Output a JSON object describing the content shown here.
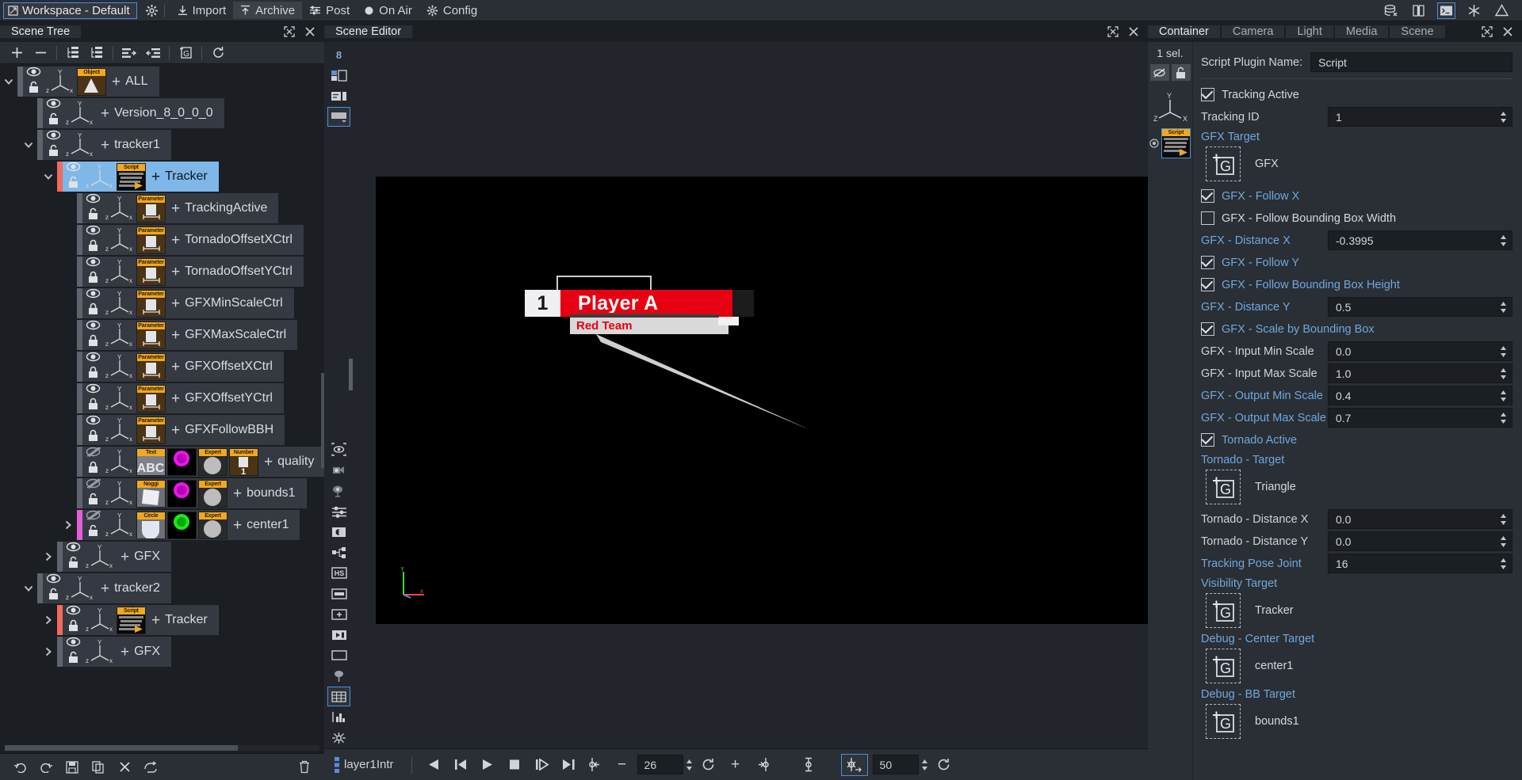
{
  "menubar": {
    "workspace_label": "Workspace - Default",
    "items": [
      {
        "label": "Import",
        "icon": "import-icon"
      },
      {
        "label": "Archive",
        "icon": "archive-icon",
        "active": true
      },
      {
        "label": "Post",
        "icon": "post-icon"
      },
      {
        "label": "On Air",
        "icon": "onair-icon"
      },
      {
        "label": "Config",
        "icon": "config-icon"
      }
    ],
    "right_icons": [
      "database-icon",
      "book-icon",
      "console-icon",
      "snowflake-icon",
      "warning-icon"
    ]
  },
  "scene_tree": {
    "tab_label": "Scene Tree",
    "toolbar": [
      "add-icon",
      "remove-icon",
      "expand-tree-icon",
      "collapse-tree-icon",
      "indent-right-icon",
      "indent-left-icon",
      "group-icon",
      "refresh-icon"
    ],
    "header_tools": [
      "maximize-icon",
      "close-icon"
    ],
    "footer": [
      "undo-icon",
      "redo-icon",
      "save-icon",
      "copy-icon",
      "delete-icon",
      "link-icon",
      "trash-icon"
    ],
    "items": [
      {
        "label": "ALL",
        "depth": 0,
        "twist": "down",
        "selected": false,
        "locked": false,
        "visible": true,
        "thumbs": [
          {
            "cap": "Object",
            "kind": "cone"
          }
        ]
      },
      {
        "label": "Version_8_0_0_0",
        "depth": 1,
        "twist": "",
        "selected": false,
        "locked": false,
        "visible": true,
        "thumbs": []
      },
      {
        "label": "tracker1",
        "depth": 1,
        "twist": "down",
        "selected": false,
        "locked": false,
        "visible": true,
        "thumbs": []
      },
      {
        "label": "Tracker",
        "depth": 2,
        "twist": "down",
        "selected": true,
        "locked": false,
        "visible": true,
        "accent": "#f2695e",
        "thumbs": [
          {
            "cap": "Script",
            "kind": "script"
          }
        ]
      },
      {
        "label": "TrackingActive",
        "depth": 3,
        "twist": "",
        "selected": false,
        "locked": false,
        "visible": true,
        "thumbs": [
          {
            "cap": "Parameter",
            "kind": "param"
          }
        ]
      },
      {
        "label": "TornadoOffsetXCtrl",
        "depth": 3,
        "twist": "",
        "selected": false,
        "locked": true,
        "visible": true,
        "thumbs": [
          {
            "cap": "Parameter",
            "kind": "param"
          }
        ]
      },
      {
        "label": "TornadoOffsetYCtrl",
        "depth": 3,
        "twist": "",
        "selected": false,
        "locked": true,
        "visible": true,
        "thumbs": [
          {
            "cap": "Parameter",
            "kind": "param"
          }
        ]
      },
      {
        "label": "GFXMinScaleCtrl",
        "depth": 3,
        "twist": "",
        "selected": false,
        "locked": true,
        "visible": true,
        "thumbs": [
          {
            "cap": "Parameter",
            "kind": "param"
          }
        ]
      },
      {
        "label": "GFXMaxScaleCtrl",
        "depth": 3,
        "twist": "",
        "selected": false,
        "locked": true,
        "visible": true,
        "thumbs": [
          {
            "cap": "Parameter",
            "kind": "param"
          }
        ]
      },
      {
        "label": "GFXOffsetXCtrl",
        "depth": 3,
        "twist": "",
        "selected": false,
        "locked": true,
        "visible": true,
        "thumbs": [
          {
            "cap": "Parameter",
            "kind": "param"
          }
        ]
      },
      {
        "label": "GFXOffsetYCtrl",
        "depth": 3,
        "twist": "",
        "selected": false,
        "locked": true,
        "visible": true,
        "thumbs": [
          {
            "cap": "Parameter",
            "kind": "param"
          }
        ]
      },
      {
        "label": "GFXFollowBBH",
        "depth": 3,
        "twist": "",
        "selected": false,
        "locked": true,
        "visible": true,
        "thumbs": [
          {
            "cap": "Parameter",
            "kind": "param"
          }
        ]
      },
      {
        "label": "quality",
        "depth": 3,
        "twist": "",
        "selected": false,
        "locked": true,
        "visible": false,
        "thumbs": [
          {
            "cap": "Text",
            "kind": "abc"
          },
          {
            "cap": "",
            "kind": "magenta"
          },
          {
            "cap": "Expert",
            "kind": "sphere"
          },
          {
            "cap": "Number",
            "kind": "number"
          }
        ]
      },
      {
        "label": "bounds1",
        "depth": 3,
        "twist": "",
        "selected": false,
        "locked": false,
        "visible": false,
        "thumbs": [
          {
            "cap": "Noggi",
            "kind": "plane"
          },
          {
            "cap": "",
            "kind": "magenta"
          },
          {
            "cap": "Expert",
            "kind": "sphere"
          }
        ]
      },
      {
        "label": "center1",
        "depth": 3,
        "twist": "right",
        "selected": false,
        "locked": false,
        "visible": false,
        "accent": "#e35fd8",
        "thumbs": [
          {
            "cap": "Circle",
            "kind": "circle"
          },
          {
            "cap": "",
            "kind": "green"
          },
          {
            "cap": "Expert",
            "kind": "sphere"
          }
        ]
      },
      {
        "label": "GFX",
        "depth": 2,
        "twist": "right",
        "selected": false,
        "locked": false,
        "visible": true,
        "thumbs": []
      },
      {
        "label": "tracker2",
        "depth": 1,
        "twist": "down",
        "selected": false,
        "locked": false,
        "visible": true,
        "thumbs": []
      },
      {
        "label": "Tracker",
        "depth": 2,
        "twist": "right",
        "selected": false,
        "locked": true,
        "visible": true,
        "accent": "#f2695e",
        "thumbs": [
          {
            "cap": "Script",
            "kind": "script"
          }
        ]
      },
      {
        "label": "GFX",
        "depth": 2,
        "twist": "right",
        "selected": false,
        "locked": false,
        "visible": true,
        "thumbs": []
      }
    ]
  },
  "scene_editor": {
    "tab_label": "Scene Editor",
    "header_tools": [
      "maximize-icon",
      "close-icon"
    ],
    "side_toolbar_top": [
      "grid-8-icon",
      "layout-split-icon",
      "info-panel-icon",
      "screen-icon"
    ],
    "side_toolbar_bottom": [
      "eye-target-icon",
      "camera-icon",
      "light-icon",
      "levels-icon",
      "contrast-icon",
      "nodes-icon",
      "hs-icon",
      "bar-icon",
      "plus-box-icon",
      "play-box-icon",
      "rect-icon",
      "pin-icon",
      "grid-icon",
      "chart-icon",
      "snap-icon"
    ],
    "selected_side_tool": "grid-icon",
    "graphic": {
      "player_number": "1",
      "player_name": "Player A",
      "team_name": "Red Team",
      "accent_color": "#e60012"
    }
  },
  "timeline": {
    "layer_label": "layer1Intr",
    "transport": [
      "step-back-icon",
      "go-start-icon",
      "play-icon",
      "stop-icon",
      "play-to-icon",
      "go-end-icon"
    ],
    "key_prev_icon": "key-prev-icon",
    "minus_label": "−",
    "frame_value": "26",
    "plus_label": "+",
    "key_next_icon": "key-next-icon",
    "key_center_icon": "key-center-icon",
    "stopwatch_icon": "anim-key-icon",
    "duration_value": "50",
    "loop_icon": "loop-icon"
  },
  "properties": {
    "tabs": [
      {
        "label": "Container",
        "active": true
      },
      {
        "label": "Camera",
        "active": false
      },
      {
        "label": "Light",
        "active": false
      },
      {
        "label": "Media",
        "active": false
      },
      {
        "label": "Scene",
        "active": false
      }
    ],
    "header_tools": [
      "maximize-icon",
      "close-icon"
    ],
    "selection_count": "1 sel.",
    "object_buttons": [
      "visibility-icon",
      "unlock-icon"
    ],
    "plugin_label": "Script Plugin Name:",
    "plugin_value": "Script",
    "rows": [
      {
        "type": "checkbox",
        "label": "Tracking Active",
        "checked": true,
        "blue": false
      },
      {
        "type": "field",
        "label": "Tracking ID",
        "value": "1",
        "blue": false,
        "spin": true
      },
      {
        "type": "section",
        "label": "GFX Target"
      },
      {
        "type": "drop",
        "name": "GFX"
      },
      {
        "type": "checkbox",
        "label": "GFX - Follow X",
        "checked": true,
        "blue": true
      },
      {
        "type": "checkbox",
        "label": "GFX - Follow Bounding Box Width",
        "checked": false,
        "blue": false
      },
      {
        "type": "field",
        "label": "GFX - Distance X",
        "value": "-0.3995",
        "blue": true,
        "spin": true
      },
      {
        "type": "checkbox",
        "label": "GFX - Follow Y",
        "checked": true,
        "blue": true
      },
      {
        "type": "checkbox",
        "label": "GFX - Follow Bounding Box Height",
        "checked": true,
        "blue": true
      },
      {
        "type": "field",
        "label": "GFX - Distance Y",
        "value": "0.5",
        "blue": true,
        "spin": true
      },
      {
        "type": "checkbox",
        "label": "GFX - Scale by Bounding Box",
        "checked": true,
        "blue": true
      },
      {
        "type": "field",
        "label": "GFX - Input Min Scale",
        "value": "0.0",
        "blue": false,
        "spin": true
      },
      {
        "type": "field",
        "label": "GFX - Input Max Scale",
        "value": "1.0",
        "blue": false,
        "spin": true
      },
      {
        "type": "field",
        "label": "GFX - Output Min Scale",
        "value": "0.4",
        "blue": true,
        "spin": true
      },
      {
        "type": "field",
        "label": "GFX - Output Max Scale",
        "value": "0.7",
        "blue": true,
        "spin": true
      },
      {
        "type": "checkbox",
        "label": "Tornado Active",
        "checked": true,
        "blue": true
      },
      {
        "type": "section",
        "label": "Tornado - Target"
      },
      {
        "type": "drop",
        "name": "Triangle"
      },
      {
        "type": "field",
        "label": "Tornado - Distance X",
        "value": "0.0",
        "blue": false,
        "spin": true
      },
      {
        "type": "field",
        "label": "Tornado - Distance Y",
        "value": "0.0",
        "blue": false,
        "spin": true
      },
      {
        "type": "field",
        "label": "Tracking Pose Joint",
        "value": "16",
        "blue": true,
        "spin": true
      },
      {
        "type": "section",
        "label": "Visibility Target"
      },
      {
        "type": "drop",
        "name": "Tracker"
      },
      {
        "type": "section",
        "label": "Debug - Center Target"
      },
      {
        "type": "drop",
        "name": "center1"
      },
      {
        "type": "section",
        "label": "Debug - BB Target"
      },
      {
        "type": "drop",
        "name": "bounds1"
      }
    ]
  },
  "colors": {
    "accent_blue": "#4a90d9",
    "label_blue": "#6fa8dc",
    "selection_blue": "#7fb7e8",
    "panel_bg": "#2a2e35",
    "app_bg": "#1b1e23",
    "red": "#e60012"
  }
}
